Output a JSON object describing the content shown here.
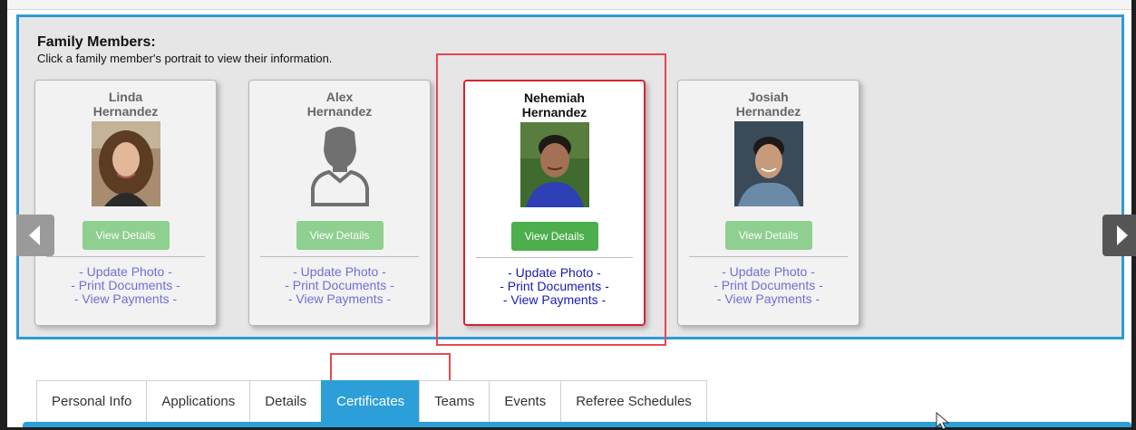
{
  "family": {
    "title": "Family Members:",
    "subtitle": "Click a family member's portrait to view their information."
  },
  "members": [
    {
      "first": "Linda",
      "last": "Hernandez",
      "view_label": "View Details",
      "update_photo": "- Update Photo -",
      "print_docs": "- Print Documents -",
      "view_payments": "- View Payments -"
    },
    {
      "first": "Alex",
      "last": "Hernandez",
      "view_label": "View Details",
      "update_photo": "- Update Photo -",
      "print_docs": "- Print Documents -",
      "view_payments": "- View Payments -"
    },
    {
      "first": "Nehemiah",
      "last": "Hernandez",
      "view_label": "View Details",
      "update_photo": "- Update Photo -",
      "print_docs": "- Print Documents -",
      "view_payments": "- View Payments -"
    },
    {
      "first": "Josiah",
      "last": "Hernandez",
      "view_label": "View Details",
      "update_photo": "- Update Photo -",
      "print_docs": "- Print Documents -",
      "view_payments": "- View Payments -"
    }
  ],
  "selected_member": "Nehemiah",
  "tabs": [
    "Personal Info",
    "Applications",
    "Details",
    "Certificates",
    "Teams",
    "Events",
    "Referee Schedules"
  ],
  "active_tab": "Certificates",
  "colors": {
    "panel_border": "#2e9bd6",
    "selected_border": "#d9232f",
    "button_active": "#4cae4c",
    "button_inactive": "#8fcf8f",
    "tab_active": "#2c9fd9",
    "highlight": "#e8474f"
  },
  "icons": {
    "prev": "chevron-left-icon",
    "next": "chevron-right-icon",
    "placeholder": "person-silhouette-icon"
  }
}
